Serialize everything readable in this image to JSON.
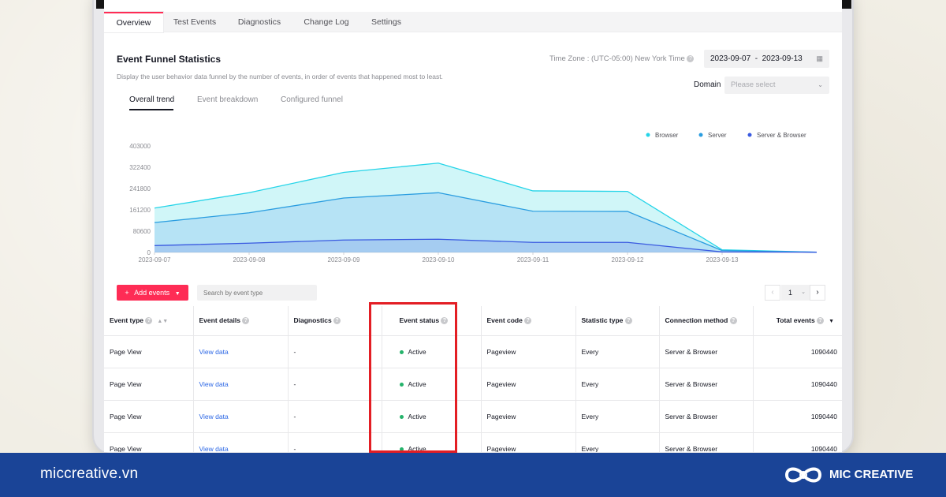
{
  "tabs": [
    "Overview",
    "Test Events",
    "Diagnostics",
    "Change Log",
    "Settings"
  ],
  "section": {
    "title": "Event Funnel Statistics",
    "description": "Display the user behavior data funnel by the number of events, in order of events that happened most to least.",
    "timezone": "Time Zone : (UTC-05:00) New York Time",
    "date_range": "2023-09-07  -  2023-09-13",
    "domain_label": "Domain",
    "domain_placeholder": "Please select"
  },
  "subtabs": [
    "Overall trend",
    "Event breakdown",
    "Configured funnel"
  ],
  "chart_data": {
    "type": "area",
    "x": [
      "2023-09-07",
      "2023-09-08",
      "2023-09-09",
      "2023-09-10",
      "2023-09-11",
      "2023-09-12",
      "2023-09-13",
      ""
    ],
    "series": [
      {
        "name": "Browser",
        "color": "#25d4e8",
        "values": [
          168000,
          226000,
          303000,
          338000,
          233000,
          231000,
          10000,
          1000
        ]
      },
      {
        "name": "Server",
        "color": "#2a9de0",
        "values": [
          113000,
          150000,
          206000,
          226000,
          156000,
          155000,
          7000,
          1000
        ]
      },
      {
        "name": "Server & Browser",
        "color": "#3a5ae0",
        "values": [
          26000,
          35000,
          47000,
          50000,
          38000,
          38000,
          2000,
          1000
        ]
      }
    ],
    "yticks": [
      "0",
      "80600",
      "161200",
      "241800",
      "322400",
      "403000"
    ],
    "ylim": [
      0,
      403000
    ],
    "legend_position": "top-right"
  },
  "toolbar": {
    "add_events": "Add events",
    "search_placeholder": "Search by event type",
    "page": "1"
  },
  "table": {
    "columns": [
      "Event type",
      "Event details",
      "Diagnostics",
      "Event status",
      "Event code",
      "Statistic type",
      "Connection method",
      "Total events"
    ],
    "rows": [
      [
        "Page View",
        "View data",
        "-",
        "Active",
        "Pageview",
        "Every",
        "Server & Browser",
        "1090440"
      ],
      [
        "Page View",
        "View data",
        "-",
        "Active",
        "Pageview",
        "Every",
        "Server & Browser",
        "1090440"
      ],
      [
        "Page View",
        "View data",
        "-",
        "Active",
        "Pageview",
        "Every",
        "Server & Browser",
        "1090440"
      ],
      [
        "Page View",
        "View data",
        "-",
        "Active",
        "Pageview",
        "Every",
        "Server & Browser",
        "1090440"
      ]
    ]
  },
  "footer": {
    "site": "miccreative.vn",
    "brand": "MIC CREATIVE"
  }
}
